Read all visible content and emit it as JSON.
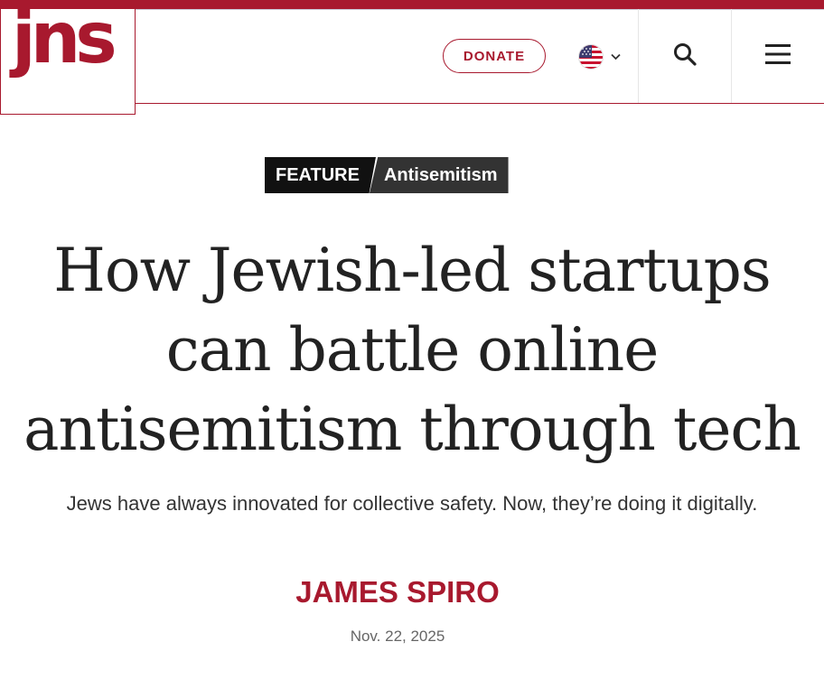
{
  "header": {
    "logo": "jns",
    "donate_label": "DONATE",
    "language_icon": "us-flag-icon",
    "search_icon": "search-icon",
    "menu_icon": "hamburger-menu-icon"
  },
  "article": {
    "kicker": {
      "type": "FEATURE",
      "topic": "Antisemitism"
    },
    "headline": "How Jewish-led startups can battle online antisemitism through tech",
    "subhead": "Jews have always innovated for collective safety. Now, they’re doing it digitally.",
    "author": "JAMES SPIRO",
    "date": "Nov. 22, 2025"
  },
  "colors": {
    "brand": "#a8192e",
    "text": "#222222",
    "kicker_bg": "#111111",
    "kicker_topic_bg": "#333333"
  }
}
